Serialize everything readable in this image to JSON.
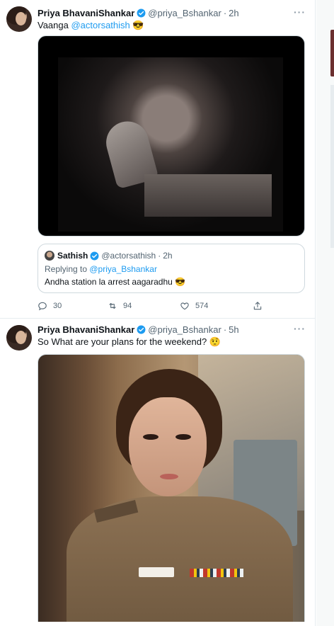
{
  "tweets": [
    {
      "author_name": "Priya BhavaniShankar",
      "handle": "@priya_Bshankar",
      "separator": "·",
      "time": "2h",
      "text_prefix": "Vaanga ",
      "text_mention": "@actorsathish",
      "text_emoji": " 😎",
      "quoted": {
        "author_name": "Sathish",
        "handle": "@actorsathish",
        "separator": "·",
        "time": "2h",
        "replying_prefix": "Replying to ",
        "replying_handle": "@priya_Bshankar",
        "text": "Andha station la arrest aagaradhu 😎"
      },
      "actions": {
        "replies": "30",
        "retweets": "94",
        "likes": "574"
      }
    },
    {
      "author_name": "Priya BhavaniShankar",
      "handle": "@priya_Bshankar",
      "separator": "·",
      "time": "5h",
      "text": "So What are your plans for the weekend? 🤨"
    }
  ],
  "icons": {
    "verified": "verified-badge-icon",
    "more": "more-options-icon",
    "reply": "reply-icon",
    "retweet": "retweet-icon",
    "like": "heart-icon",
    "share": "share-icon"
  },
  "colors": {
    "accent": "#1d9bf0",
    "secondary_text": "#536471",
    "border": "#cfd9de"
  }
}
